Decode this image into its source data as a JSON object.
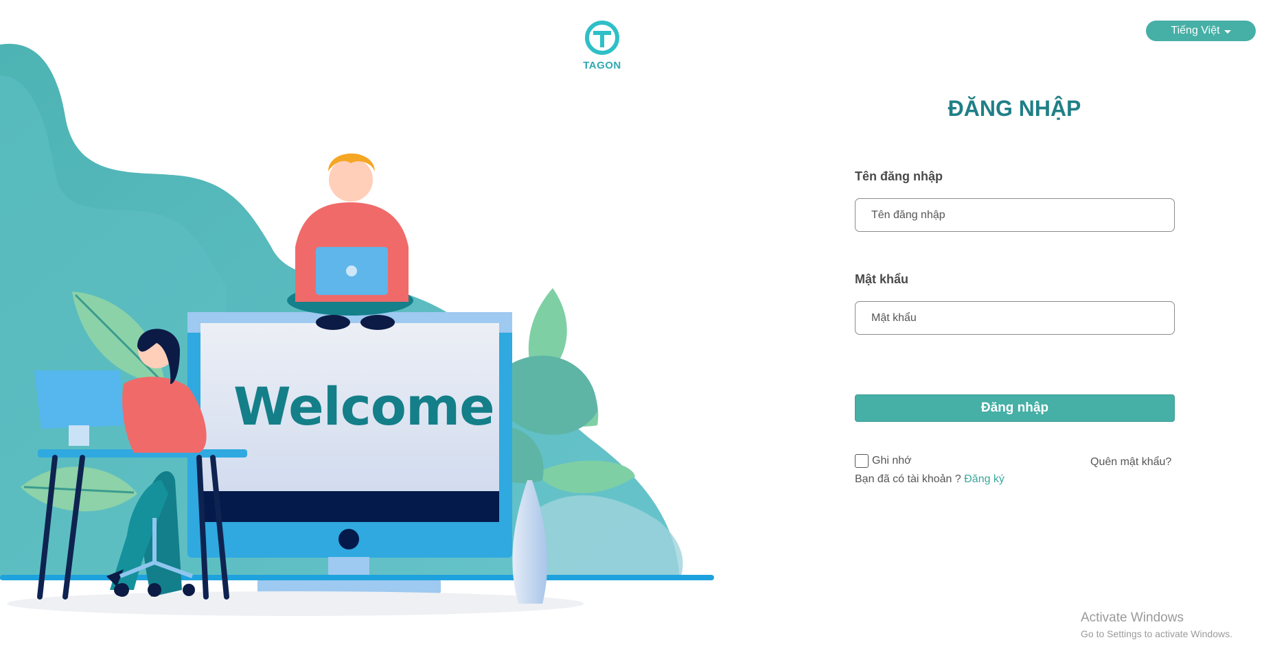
{
  "brand": {
    "name": "TAGON",
    "color": "#2fa8b0"
  },
  "language": {
    "label": "Tiếng Việt"
  },
  "illustration": {
    "welcome_text": "Welcome"
  },
  "login": {
    "title": "ĐĂNG NHẬP",
    "username_label": "Tên đăng nhập",
    "username_placeholder": "Tên đăng nhập",
    "password_label": "Mật khẩu",
    "password_placeholder": "Mật khẩu",
    "submit_label": "Đăng nhập",
    "remember_label": "Ghi nhớ",
    "remember_checked": false,
    "forgot_label": "Quên mật khẩu?",
    "register_prompt": "Bạn đã có tài khoản ?",
    "register_link": "Đăng ký"
  },
  "os_watermark": {
    "title": "Activate Windows",
    "subtitle": "Go to Settings to activate Windows."
  },
  "colors": {
    "accent": "#46afa6",
    "title": "#207f87",
    "welcome": "#147f88"
  }
}
